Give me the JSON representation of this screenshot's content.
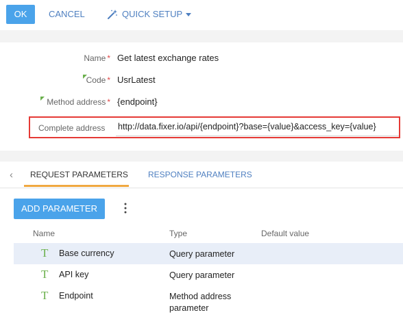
{
  "toolbar": {
    "ok_label": "OK",
    "cancel_label": "CANCEL",
    "quick_setup_label": "QUICK SETUP"
  },
  "form": {
    "name": {
      "label": "Name",
      "value": "Get latest exchange rates"
    },
    "code": {
      "label": "Code",
      "value": "UsrLatest"
    },
    "method_address": {
      "label": "Method address",
      "value": "{endpoint}"
    },
    "complete_address": {
      "label": "Complete address",
      "value": "http://data.fixer.io/api/{endpoint}?base={value}&access_key={value}"
    },
    "required_mark": "*"
  },
  "tabs": {
    "request": "REQUEST PARAMETERS",
    "response": "RESPONSE PARAMETERS"
  },
  "params": {
    "add_label": "ADD PARAMETER",
    "columns": {
      "name": "Name",
      "type": "Type",
      "default": "Default value"
    },
    "type_glyph": "T",
    "rows": [
      {
        "name": "Base currency",
        "type": "Query parameter",
        "default": ""
      },
      {
        "name": "API key",
        "type": "Query parameter",
        "default": ""
      },
      {
        "name": "Endpoint",
        "type": "Method address parameter",
        "default": ""
      }
    ]
  },
  "colors": {
    "primary": "#4aa3ea",
    "link": "#4e7fc0",
    "required": "#e04646",
    "highlight_border": "#e53935",
    "tab_underline": "#f0a840",
    "type_icon": "#6ab04c",
    "selected_row": "#e8eef8"
  },
  "icons": {
    "quick_setup": "magic-wand-icon",
    "dropdown": "caret-down-icon",
    "back": "chevron-left-icon",
    "more": "more-vertical-icon",
    "param_type": "text-type-icon",
    "localizable": "green-corner-flag-icon"
  }
}
